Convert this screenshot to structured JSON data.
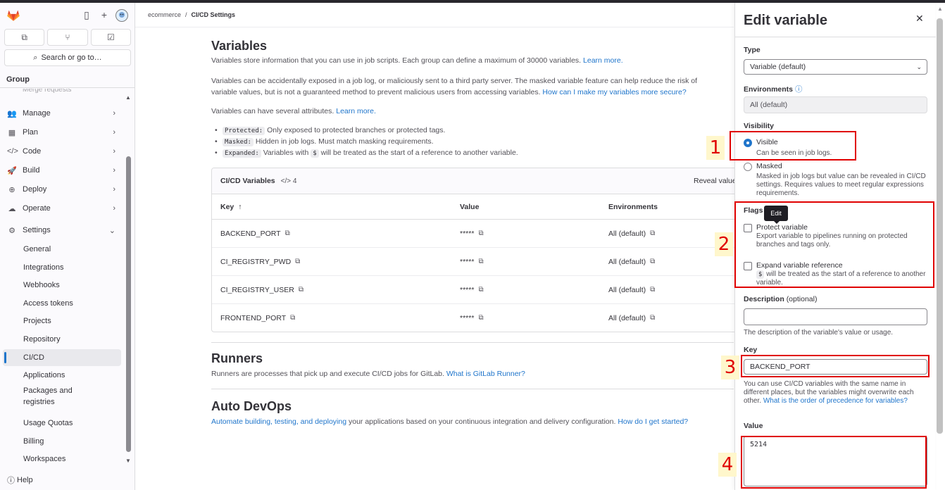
{
  "breadcrumb": {
    "group": "ecommerce",
    "sep": "/",
    "current": "CI/CD Settings"
  },
  "sidebar": {
    "search_label": "Search or go to…",
    "group_label": "Group",
    "cut_item": "Merge requests",
    "items": [
      {
        "label": "Manage",
        "icon": "users-icon"
      },
      {
        "label": "Plan",
        "icon": "calendar-icon"
      },
      {
        "label": "Code",
        "icon": "code-icon"
      },
      {
        "label": "Build",
        "icon": "rocket-icon"
      },
      {
        "label": "Deploy",
        "icon": "deploy-icon"
      },
      {
        "label": "Operate",
        "icon": "cloud-gear-icon"
      },
      {
        "label": "Settings",
        "icon": "gear-icon"
      }
    ],
    "sub_items": [
      "General",
      "Integrations",
      "Webhooks",
      "Access tokens",
      "Projects",
      "Repository",
      "CI/CD",
      "Applications",
      "Packages and registries",
      "Usage Quotas",
      "Billing",
      "Workspaces"
    ],
    "help_label": "Help"
  },
  "variables": {
    "title": "Variables",
    "intro": "Variables store information that you can use in job scripts. Each group can define a maximum of 30000 variables.",
    "intro_link": "Learn more.",
    "warning": "Variables can be accidentally exposed in a job log, or maliciously sent to a third party server. The masked variable feature can help reduce the risk of",
    "warning2": "variable values, but is not a guaranteed method to prevent malicious users from accessing variables.",
    "warning_link": "How can I make my variables more secure?",
    "attrs_intro": "Variables can have several attributes.",
    "attrs_link": "Learn more.",
    "attrs": [
      {
        "code": "Protected:",
        "text": "Only exposed to protected branches or protected tags."
      },
      {
        "code": "Masked:",
        "text": "Hidden in job logs. Must match masking requirements."
      },
      {
        "code": "Expanded:",
        "text": "Variables with",
        "code2": "$",
        "text2": "will be treated as the start of a reference to another variable."
      }
    ]
  },
  "table": {
    "title": "CI/CD Variables",
    "count": "4",
    "reveal": "Reveal value",
    "headers": {
      "key": "Key",
      "value": "Value",
      "env": "Environments"
    },
    "sort_icon": "↑",
    "rows": [
      {
        "key": "BACKEND_PORT",
        "value": "*****",
        "env": "All (default)"
      },
      {
        "key": "CI_REGISTRY_PWD",
        "value": "*****",
        "env": "All (default)"
      },
      {
        "key": "CI_REGISTRY_USER",
        "value": "*****",
        "env": "All (default)"
      },
      {
        "key": "FRONTEND_PORT",
        "value": "*****",
        "env": "All (default)"
      }
    ]
  },
  "runners": {
    "title": "Runners",
    "text": "Runners are processes that pick up and execute CI/CD jobs for GitLab.",
    "link": "What is GitLab Runner?"
  },
  "autodevops": {
    "title": "Auto DevOps",
    "link1": "Automate building, testing, and deploying",
    "text": "your applications based on your continuous integration and delivery configuration.",
    "link2": "How do I get started?"
  },
  "drawer": {
    "title": "Edit variable",
    "type_label": "Type",
    "type_value": "Variable (default)",
    "env_label": "Environments",
    "env_value": "All (default)",
    "visibility_label": "Visibility",
    "visible_title": "Visible",
    "visible_desc": "Can be seen in job logs.",
    "masked_title": "Masked",
    "masked_desc": "Masked in job logs but value can be revealed in CI/CD settings. Requires values to meet regular expressions requirements.",
    "flags_label": "Flags",
    "tooltip": "Edit",
    "protect_title": "Protect variable",
    "protect_desc": "Export variable to pipelines running on protected branches and tags only.",
    "expand_title": "Expand variable reference",
    "expand_code": "$",
    "expand_desc": "will be treated as the start of a reference to another variable.",
    "desc_label": "Description",
    "desc_optional": "(optional)",
    "desc_help": "The description of the variable's value or usage.",
    "key_label": "Key",
    "key_value": "BACKEND_PORT",
    "key_help": "You can use CI/CD variables with the same name in different places, but the variables might overwrite each other.",
    "key_help_link": "What is the order of precedence for variables?",
    "value_label": "Value",
    "value_value": "5214"
  },
  "annotations": [
    "1",
    "2",
    "3",
    "4"
  ],
  "colors": {
    "link": "#1f75cb",
    "annotation": "#e00000",
    "annotation_bg": "#fff7cc"
  }
}
